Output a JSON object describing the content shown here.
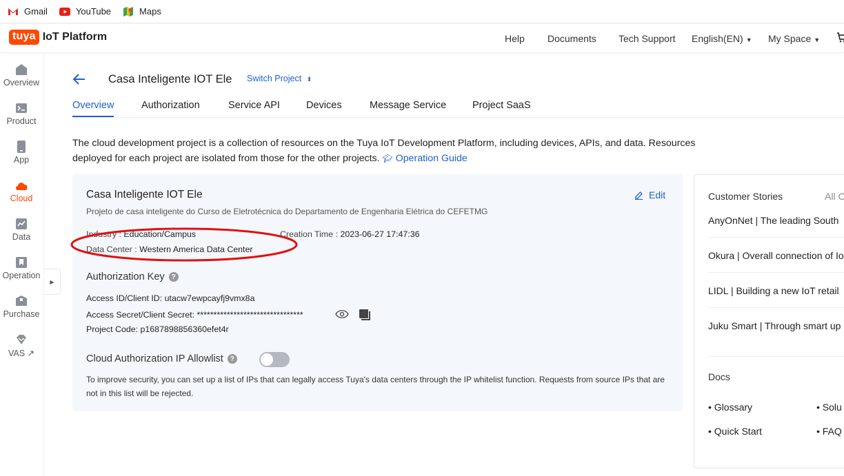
{
  "bookmarks": [
    {
      "label": "Gmail",
      "icon": "gmail-icon"
    },
    {
      "label": "YouTube",
      "icon": "youtube-icon"
    },
    {
      "label": "Maps",
      "icon": "maps-icon"
    }
  ],
  "header": {
    "logo_badge": "tuya",
    "logo_text": "IoT Platform",
    "nav": [
      "Help",
      "Documents",
      "Tech Support",
      "English(EN)",
      "My Space"
    ]
  },
  "sidebar": {
    "items": [
      {
        "label": "Overview",
        "icon": "home-icon"
      },
      {
        "label": "Product",
        "icon": "terminal-icon"
      },
      {
        "label": "App",
        "icon": "phone-icon"
      },
      {
        "label": "Cloud",
        "icon": "cloud-icon",
        "active": true
      },
      {
        "label": "Data",
        "icon": "chart-icon"
      },
      {
        "label": "Operation",
        "icon": "bookmark-icon"
      },
      {
        "label": "Purchase",
        "icon": "box-icon"
      },
      {
        "label": "VAS",
        "icon": "diamond-icon"
      }
    ]
  },
  "project": {
    "title": "Casa Inteligente IOT Ele",
    "switch_label": "Switch Project"
  },
  "tabs": [
    "Overview",
    "Authorization",
    "Service API",
    "Devices",
    "Message Service",
    "Project SaaS"
  ],
  "intro": {
    "text": "The cloud development project is a collection of resources on the Tuya IoT Development Platform, including devices, APIs, and data. Resources deployed for each project are isolated from those for the other projects.",
    "guide_label": "Operation Guide"
  },
  "card": {
    "title": "Casa Inteligente IOT Ele",
    "description": "Projeto de casa inteligente do Curso de Eletrotécnica do Departamento de Engenharia Elétrica do CEFETMG",
    "edit_label": "Edit",
    "industry_label": "Industry :",
    "industry_value": "Education/Campus",
    "creation_label": "Creation Time :",
    "creation_value": "2023-06-27 17:47:36",
    "datacenter_label": "Data Center :",
    "datacenter_value": "Western America Data Center",
    "auth_key_title": "Authorization Key",
    "access_id": "Access ID/Client ID: utacw7ewpcayfj9vmx8a",
    "access_secret": "Access Secret/Client Secret: ********************************",
    "project_code": "Project Code: p1687898856360efet4r",
    "allowlist_title": "Cloud Authorization IP Allowlist",
    "allowlist_enabled": false,
    "allowlist_note": "To improve security, you can set up a list of IPs that can legally access Tuya's data centers through the IP whitelist function. Requests from source IPs that are not in this list will be rejected."
  },
  "right_panel": {
    "stories_title": "Customer Stories",
    "all_label": "All C",
    "stories": [
      "AnyOnNet | The leading South",
      "Okura | Overall connection of Io",
      "LIDL | Building a new IoT retail",
      "Juku Smart | Through smart up"
    ],
    "docs_title": "Docs",
    "docs": [
      "Glossary",
      "Solu",
      "Quick Start",
      "FAQ"
    ]
  },
  "colors": {
    "accent": "#1f5fd6",
    "brand": "#ff4800",
    "annotation": "#e01010"
  }
}
